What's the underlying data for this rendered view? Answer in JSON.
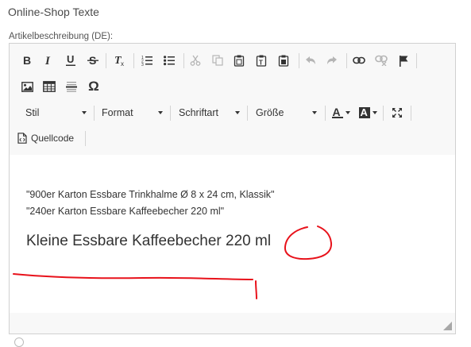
{
  "section": {
    "title": "Online-Shop Texte"
  },
  "field": {
    "label": "Artikelbeschreibung (DE):"
  },
  "toolbar": {
    "combos": [
      {
        "label": "Stil"
      },
      {
        "label": "Format"
      },
      {
        "label": "Schriftart"
      },
      {
        "label": "Größe"
      }
    ],
    "source_label": "Quellcode",
    "special_char_glyph": "Ω",
    "text_color_glyph": "A",
    "bg_color_glyph": "A",
    "clear_format_glyph": "T"
  },
  "content": {
    "lines": [
      "\"900er Karton Essbare Trinkhalme Ø 8 x 24 cm, Klassik\"",
      "\"240er Karton Essbare Kaffeebecher 220 ml\""
    ],
    "heading": "Kleine Essbare Kaffeebecher 220 ml"
  },
  "annotation_color": "#e8121b"
}
